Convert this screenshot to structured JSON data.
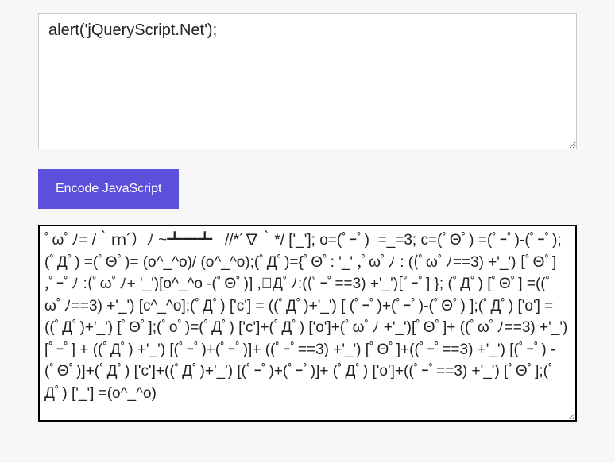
{
  "input": {
    "value": "alert('jQueryScript.Net');"
  },
  "button": {
    "label": "Encode JavaScript"
  },
  "output": {
    "value": "ﾟωﾟﾉ= /｀ｍ´）ﾉ ~┻━┻   //*´∇｀*/ ['_']; o=(ﾟｰﾟ)  =_=3; c=(ﾟΘﾟ) =(ﾟｰﾟ)-(ﾟｰﾟ); (ﾟДﾟ) =(ﾟΘﾟ)= (o^_^o)/ (o^_^o);(ﾟДﾟ)={ﾟΘﾟ: '_' ,ﾟωﾟﾉ : ((ﾟωﾟﾉ==3) +'_') [ﾟΘﾟ] ,ﾟｰﾟﾉ :(ﾟωﾟﾉ+ '_')[o^_^o -(ﾟΘﾟ)] ,ﾟДﾟﾉ:((ﾟｰﾟ==3) +'_')[ﾟｰﾟ] }; (ﾟДﾟ) [ﾟΘﾟ] =((ﾟωﾟﾉ==3) +'_') [c^_^o];(ﾟДﾟ) ['c'] = ((ﾟДﾟ)+'_') [ (ﾟｰﾟ)+(ﾟｰﾟ)-(ﾟΘﾟ) ];(ﾟДﾟ) ['o'] = ((ﾟДﾟ)+'_') [ﾟΘﾟ];(ﾟoﾟ)=(ﾟДﾟ) ['c']+(ﾟДﾟ) ['o']+(ﾟωﾟﾉ +'_')[ﾟΘﾟ]+ ((ﾟωﾟﾉ==3) +'_') [ﾟｰﾟ] + ((ﾟДﾟ) +'_') [(ﾟｰﾟ)+(ﾟｰﾟ)]+ ((ﾟｰﾟ==3) +'_') [ﾟΘﾟ]+((ﾟｰﾟ==3) +'_') [(ﾟｰﾟ) - (ﾟΘﾟ)]+(ﾟДﾟ) ['c']+((ﾟДﾟ)+'_') [(ﾟｰﾟ)+(ﾟｰﾟ)]+ (ﾟДﾟ) ['o']+((ﾟｰﾟ==3) +'_') [ﾟΘﾟ];(ﾟДﾟ) ['_'] =(o^_^o)"
  },
  "colors": {
    "accent": "#5b4fdb",
    "bg": "#f7f7f7",
    "border_light": "#c9c9c9",
    "border_dark": "#000000"
  }
}
